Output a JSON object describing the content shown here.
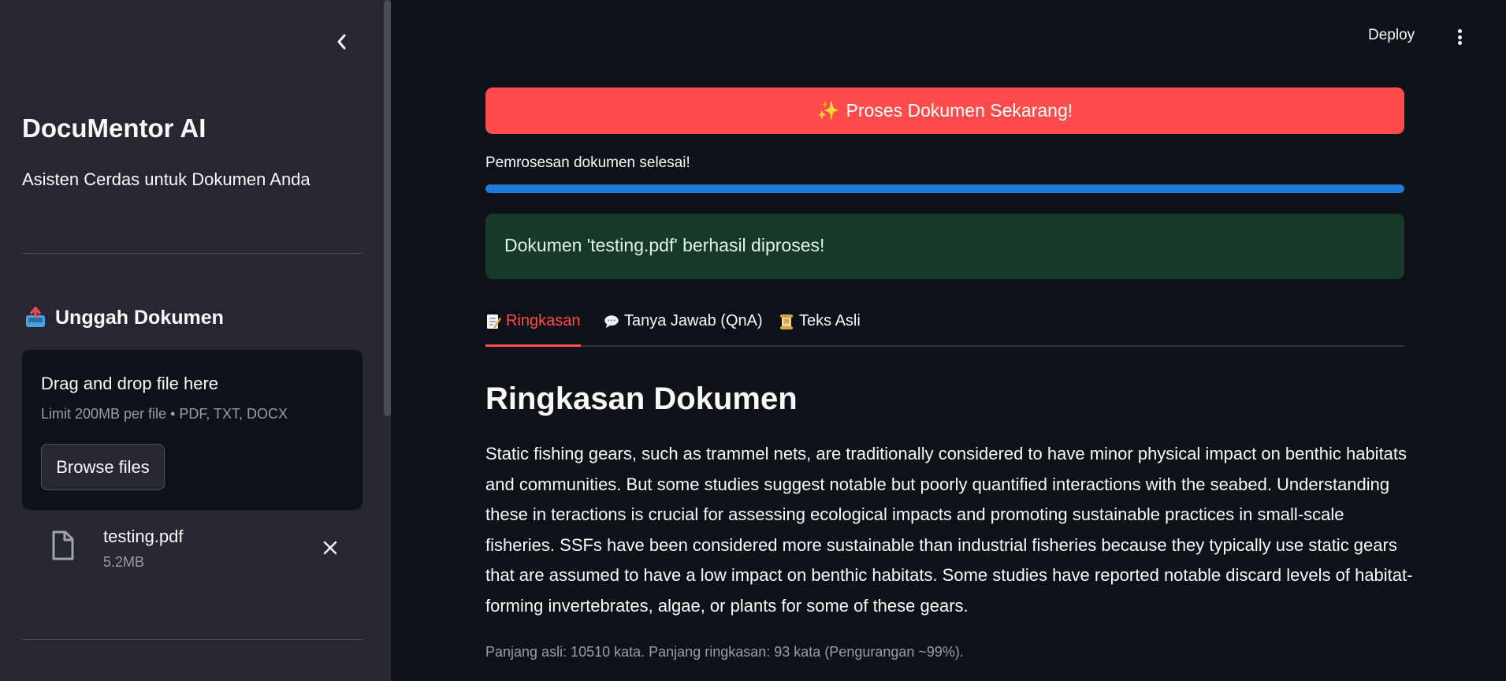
{
  "sidebar": {
    "title": "DocuMentor AI",
    "subtitle": "Asisten Cerdas untuk Dokumen Anda",
    "upload_heading": "Unggah Dokumen",
    "dropzone": {
      "title": "Drag and drop file here",
      "limit": "Limit 200MB per file • PDF, TXT, DOCX",
      "browse_label": "Browse files"
    },
    "file": {
      "name": "testing.pdf",
      "size": "5.2MB"
    }
  },
  "header": {
    "deploy_label": "Deploy"
  },
  "main": {
    "process_button": {
      "icon": "✨",
      "label": "Proses Dokumen Sekarang!"
    },
    "progress": {
      "label": "Pemrosesan dokumen selesai!",
      "value_percent": 100,
      "color": "#1f7bd8"
    },
    "success_message": "Dokumen 'testing.pdf' berhasil diproses!",
    "tabs": [
      {
        "label": "Ringkasan",
        "icon": "memo-icon",
        "active": true
      },
      {
        "label": "Tanya Jawab (QnA)",
        "icon": "speech-bubble-icon",
        "active": false
      },
      {
        "label": "Teks Asli",
        "icon": "scroll-icon",
        "active": false
      }
    ],
    "summary_heading": "Ringkasan Dokumen",
    "summary_text": "Static fishing gears, such as trammel nets, are traditionally considered to have minor physical impact on benthic habitats and communities. But some studies suggest notable but poorly quantified interactions with the seabed. Understanding these in teractions is crucial for assessing ecological impacts and promoting sustainable practices in small-scale fisheries. SSFs have been considered more sustainable than industrial fisheries because they typically use static gears that are assumed to have a low impact on benthic habitats. Some studies have reported notable discard levels of habitat-forming invertebrates, algae, or plants for some of these gears.",
    "summary_stats": "Panjang asli: 10510 kata. Panjang ringkasan: 93 kata (Pengurangan ~99%)."
  },
  "colors": {
    "accent": "#ff4b4b",
    "sidebar_bg": "#262730",
    "main_bg": "#0e1117",
    "success_bg": "#173928"
  }
}
